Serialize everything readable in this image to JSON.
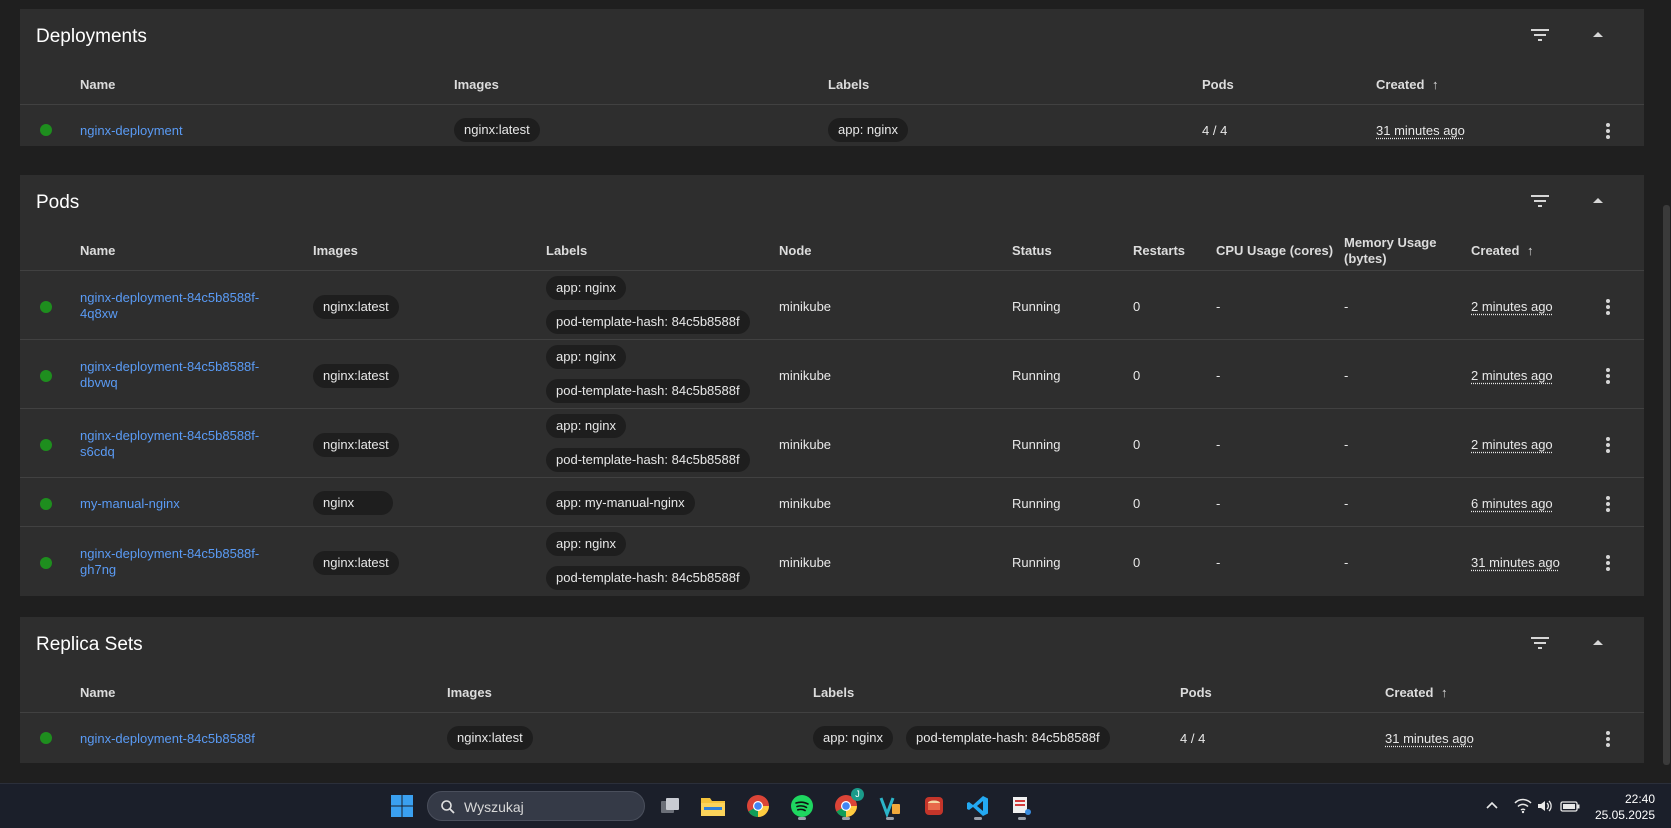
{
  "deployments": {
    "title": "Deployments",
    "columns": [
      "Name",
      "Images",
      "Labels",
      "Pods",
      "Created"
    ],
    "rows": [
      {
        "name": "nginx-deployment",
        "image": "nginx:latest",
        "label": "app: nginx",
        "pods": "4 / 4",
        "created": "31 minutes ago"
      }
    ]
  },
  "pods": {
    "title": "Pods",
    "columns": [
      "Name",
      "Images",
      "Labels",
      "Node",
      "Status",
      "Restarts",
      "CPU Usage (cores)",
      "Memory Usage (bytes)",
      "Created"
    ],
    "rows": [
      {
        "name_line1": "nginx-deployment-84c5b8588f-",
        "name_line2": "4q8xw",
        "image": "nginx:latest",
        "label1": "app: nginx",
        "label2": "pod-template-hash: 84c5b8588f",
        "node": "minikube",
        "status": "Running",
        "restarts": "0",
        "cpu": "-",
        "memory": "-",
        "created": "2 minutes ago"
      },
      {
        "name_line1": "nginx-deployment-84c5b8588f-",
        "name_line2": "dbvwq",
        "image": "nginx:latest",
        "label1": "app: nginx",
        "label2": "pod-template-hash: 84c5b8588f",
        "node": "minikube",
        "status": "Running",
        "restarts": "0",
        "cpu": "-",
        "memory": "-",
        "created": "2 minutes ago"
      },
      {
        "name_line1": "nginx-deployment-84c5b8588f-",
        "name_line2": "s6cdq",
        "image": "nginx:latest",
        "label1": "app: nginx",
        "label2": "pod-template-hash: 84c5b8588f",
        "node": "minikube",
        "status": "Running",
        "restarts": "0",
        "cpu": "-",
        "memory": "-",
        "created": "2 minutes ago"
      },
      {
        "name_line1": "my-manual-nginx",
        "name_line2": "",
        "image": "nginx",
        "label1": "app: my-manual-nginx",
        "label2": "",
        "node": "minikube",
        "status": "Running",
        "restarts": "0",
        "cpu": "-",
        "memory": "-",
        "created": "6 minutes ago"
      },
      {
        "name_line1": "nginx-deployment-84c5b8588f-",
        "name_line2": "gh7ng",
        "image": "nginx:latest",
        "label1": "app: nginx",
        "label2": "pod-template-hash: 84c5b8588f",
        "node": "minikube",
        "status": "Running",
        "restarts": "0",
        "cpu": "-",
        "memory": "-",
        "created": "31 minutes ago"
      }
    ]
  },
  "replica_sets": {
    "title": "Replica Sets",
    "columns": [
      "Name",
      "Images",
      "Labels",
      "Pods",
      "Created"
    ],
    "rows": [
      {
        "name": "nginx-deployment-84c5b8588f",
        "image": "nginx:latest",
        "label1": "app: nginx",
        "label2": "pod-template-hash: 84c5b8588f",
        "pods": "4 / 4",
        "created": "31 minutes ago"
      }
    ]
  },
  "sort_indicator": "↑",
  "icons": [
    "filter-icon",
    "collapse-icon",
    "more-vert-icon",
    "status-running-icon"
  ],
  "colors": {
    "link": "#5a9bf5",
    "status_running": "#1e8e1e",
    "card_bg": "#2e2e2e",
    "page_bg": "#1f1f1f"
  },
  "taskbar": {
    "search_placeholder": "Wyszukaj",
    "clock_time": "22:40",
    "clock_date": "25.05.2025",
    "chrome_profile_badge": "J"
  }
}
